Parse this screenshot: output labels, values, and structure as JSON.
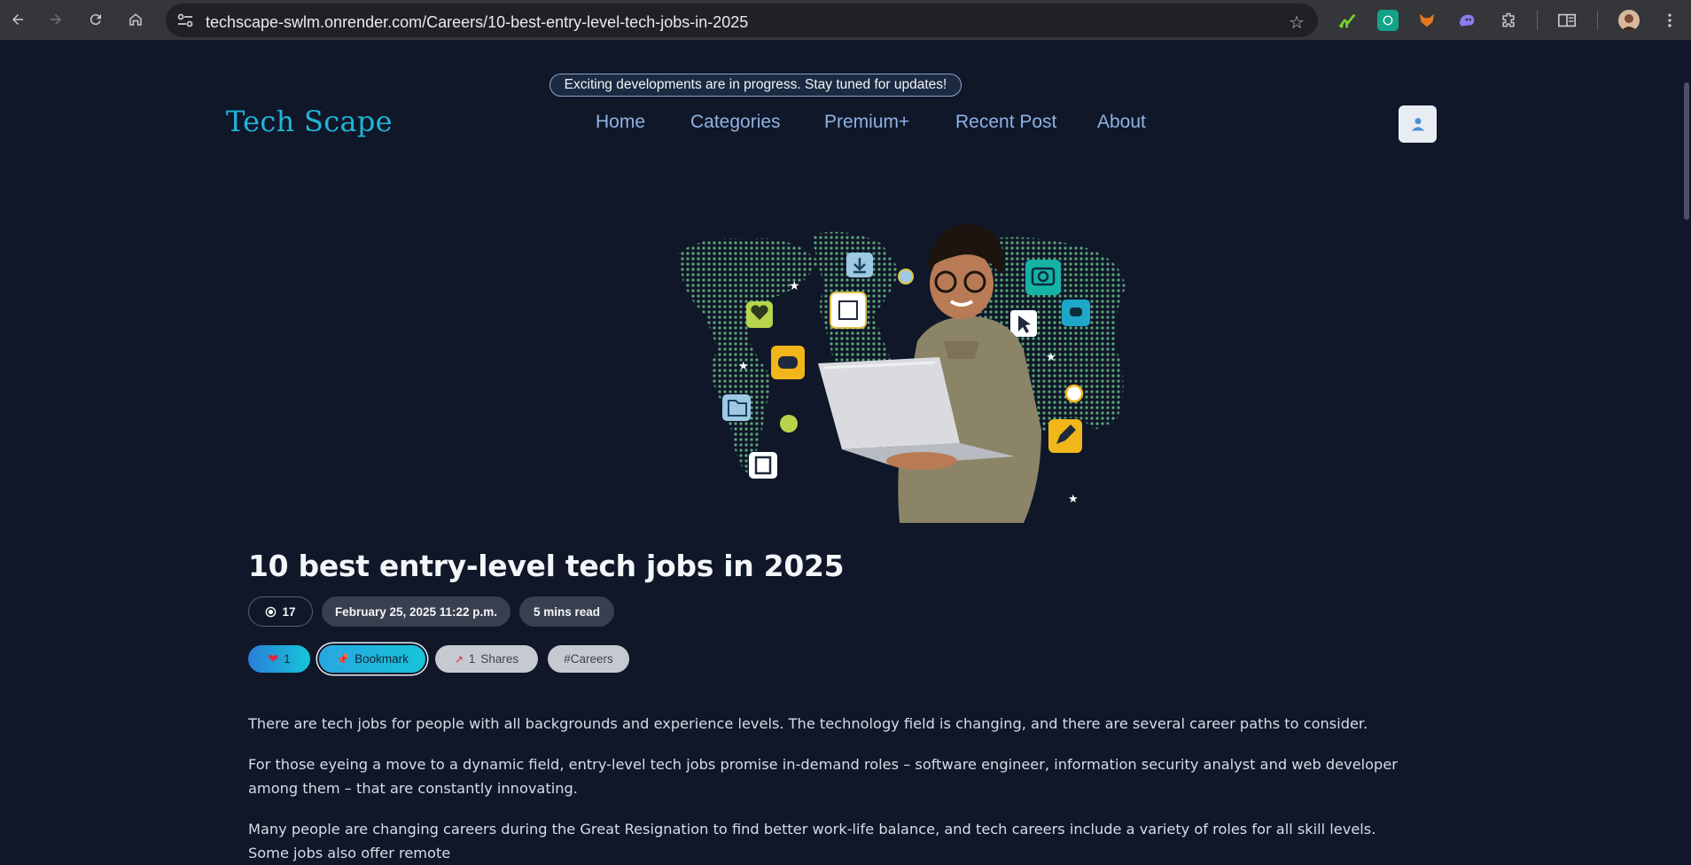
{
  "browser": {
    "url": "techscape-swlm.onrender.com/Careers/10-best-entry-level-tech-jobs-in-2025",
    "icons": [
      "back-icon",
      "forward-icon",
      "reload-icon",
      "home-icon",
      "site-info-icon",
      "bookmark-star-icon",
      "extensions-icon",
      "reading-list-icon",
      "profile-avatar-icon",
      "menu-kebab-icon"
    ]
  },
  "announcement": "Exciting developments are in progress. Stay tuned for updates!",
  "brand": "Tech Scape",
  "nav": {
    "items": [
      {
        "label": "Home"
      },
      {
        "label": "Categories"
      },
      {
        "label": "Premium+"
      },
      {
        "label": "Recent Post"
      },
      {
        "label": "About"
      }
    ]
  },
  "article": {
    "title": "10 best entry-level tech jobs in 2025",
    "views": "17",
    "date": "February 25, 2025 11:22 p.m.",
    "read_time": "5 mins read",
    "likes": "1",
    "bookmark_label": "Bookmark",
    "shares_count": "1",
    "shares_label": "Shares",
    "tag": "#Careers",
    "paragraphs": [
      "There are tech jobs for people with all backgrounds and experience levels. The technology field is changing, and there are several career paths to consider.",
      "For those eyeing a move to a dynamic field, entry-level tech jobs promise in-demand roles – software engineer, information security analyst and web developer among them – that are constantly innovating.",
      "Many people are changing careers during the Great Resignation to find better work-life balance, and tech careers include a variety of roles for all skill levels. Some jobs also offer remote"
    ]
  },
  "colors": {
    "page_bg": "#0f1729",
    "brand": "#22b5d8",
    "nav_link": "#8fb3e2",
    "accent_gradient_start": "#2b7ed8",
    "accent_gradient_end": "#14c6d9"
  }
}
